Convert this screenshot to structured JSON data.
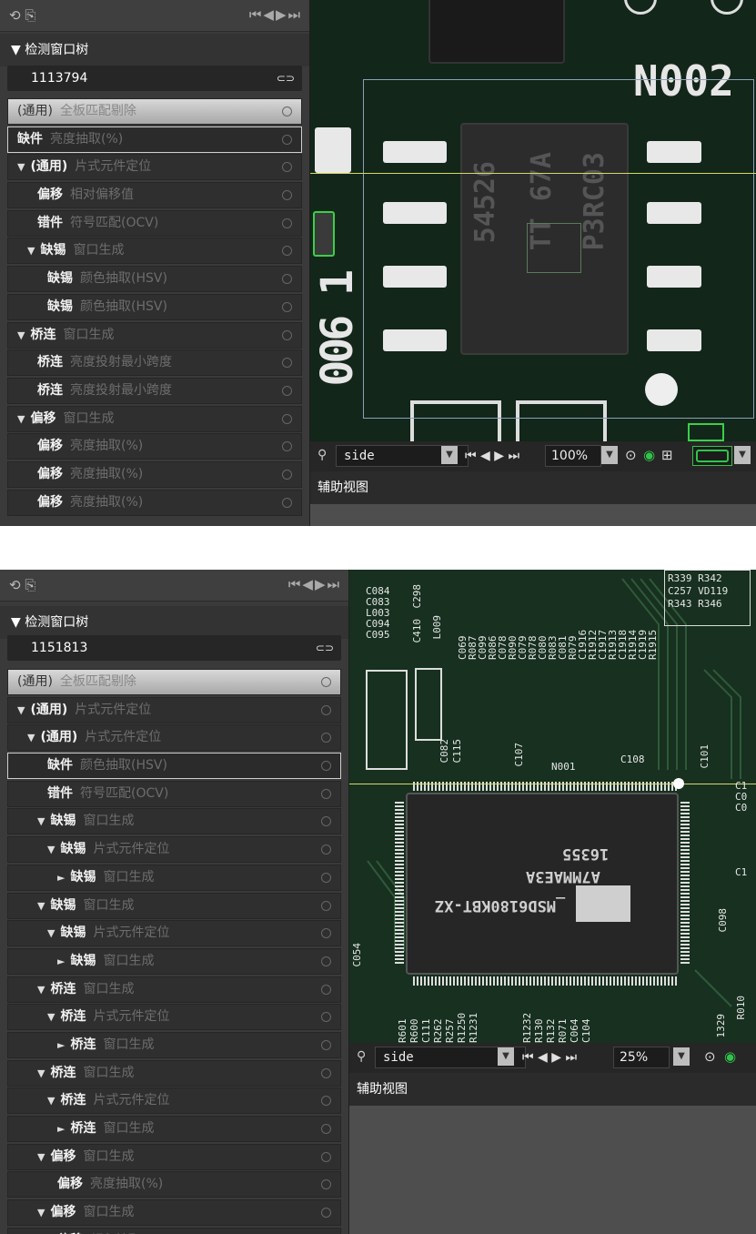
{
  "shot1": {
    "toolbar": {
      "left_icons": "⟲ ⎘",
      "nav": [
        "⏮",
        "◀",
        "▶",
        "⏭"
      ]
    },
    "tree_header": "▼ 检测窗口树",
    "id_value": "1113794",
    "rows": [
      {
        "level": 0,
        "arrow": "",
        "kw": "(通用)",
        "desc": "全板匹配剔除",
        "style": "root"
      },
      {
        "level": 0,
        "arrow": "",
        "kw": "缺件",
        "desc": "亮度抽取(%)",
        "style": "sel"
      },
      {
        "level": 0,
        "arrow": "▼",
        "kw": "(通用)",
        "desc": "片式元件定位"
      },
      {
        "level": 2,
        "arrow": "",
        "kw": "偏移",
        "desc": "相对偏移值"
      },
      {
        "level": 2,
        "arrow": "",
        "kw": "错件",
        "desc": "符号匹配(OCV)"
      },
      {
        "level": 1,
        "arrow": "▼",
        "kw": "缺锡",
        "desc": "窗口生成"
      },
      {
        "level": 3,
        "arrow": "",
        "kw": "缺锡",
        "desc": "颜色抽取(HSV)"
      },
      {
        "level": 3,
        "arrow": "",
        "kw": "缺锡",
        "desc": "颜色抽取(HSV)"
      },
      {
        "level": 0,
        "arrow": "▼",
        "kw": "桥连",
        "desc": "窗口生成"
      },
      {
        "level": 2,
        "arrow": "",
        "kw": "桥连",
        "desc": "亮度投射最小跨度"
      },
      {
        "level": 2,
        "arrow": "",
        "kw": "桥连",
        "desc": "亮度投射最小跨度"
      },
      {
        "level": 0,
        "arrow": "▼",
        "kw": "偏移",
        "desc": "窗口生成"
      },
      {
        "level": 2,
        "arrow": "",
        "kw": "偏移",
        "desc": "亮度抽取(%)"
      },
      {
        "level": 2,
        "arrow": "",
        "kw": "偏移",
        "desc": "亮度抽取(%)"
      },
      {
        "level": 2,
        "arrow": "",
        "kw": "偏移",
        "desc": "亮度抽取(%)"
      }
    ],
    "board": {
      "label_big": "N002",
      "chip_text": [
        "54526",
        "TT 67A",
        "P3RC03"
      ],
      "side_text": "006 1"
    },
    "controls": {
      "view": "side",
      "zoom": "100%"
    },
    "aux_title": "辅助视图"
  },
  "shot2": {
    "toolbar": {
      "left_icons": "⟲ ⎘",
      "nav": [
        "⏮",
        "◀",
        "▶",
        "⏭"
      ]
    },
    "tree_header": "▼ 检测窗口树",
    "id_value": "1151813",
    "rows": [
      {
        "level": 0,
        "arrow": "",
        "kw": "(通用)",
        "desc": "全板匹配剔除",
        "style": "root"
      },
      {
        "level": 0,
        "arrow": "▼",
        "kw": "(通用)",
        "desc": "片式元件定位"
      },
      {
        "level": 1,
        "arrow": "▼",
        "kw": "(通用)",
        "desc": "片式元件定位"
      },
      {
        "level": 3,
        "arrow": "",
        "kw": "缺件",
        "desc": "颜色抽取(HSV)",
        "style": "sel"
      },
      {
        "level": 3,
        "arrow": "",
        "kw": "错件",
        "desc": "符号匹配(OCV)"
      },
      {
        "level": 2,
        "arrow": "▼",
        "kw": "缺锡",
        "desc": "窗口生成"
      },
      {
        "level": 3,
        "arrow": "▼",
        "kw": "缺锡",
        "desc": "片式元件定位"
      },
      {
        "level": 4,
        "arrow": "►",
        "kw": "缺锡",
        "desc": "窗口生成"
      },
      {
        "level": 2,
        "arrow": "▼",
        "kw": "缺锡",
        "desc": "窗口生成"
      },
      {
        "level": 3,
        "arrow": "▼",
        "kw": "缺锡",
        "desc": "片式元件定位"
      },
      {
        "level": 4,
        "arrow": "►",
        "kw": "缺锡",
        "desc": "窗口生成"
      },
      {
        "level": 2,
        "arrow": "▼",
        "kw": "桥连",
        "desc": "窗口生成"
      },
      {
        "level": 3,
        "arrow": "▼",
        "kw": "桥连",
        "desc": "片式元件定位"
      },
      {
        "level": 4,
        "arrow": "►",
        "kw": "桥连",
        "desc": "窗口生成"
      },
      {
        "level": 2,
        "arrow": "▼",
        "kw": "桥连",
        "desc": "窗口生成"
      },
      {
        "level": 3,
        "arrow": "▼",
        "kw": "桥连",
        "desc": "片式元件定位"
      },
      {
        "level": 4,
        "arrow": "►",
        "kw": "桥连",
        "desc": "窗口生成"
      },
      {
        "level": 2,
        "arrow": "▼",
        "kw": "偏移",
        "desc": "窗口生成"
      },
      {
        "level": 4,
        "arrow": "",
        "kw": "偏移",
        "desc": "亮度抽取(%)"
      },
      {
        "level": 2,
        "arrow": "▼",
        "kw": "偏移",
        "desc": "窗口生成"
      },
      {
        "level": 4,
        "arrow": "",
        "kw": "偏移",
        "desc": "颜色抽取(HSV)"
      }
    ],
    "board": {
      "chip_lines": [
        "16355",
        "A7MMAE3A",
        "_MSD6180KBT-XZ"
      ],
      "labels_top": [
        "C084",
        "C083",
        "L003",
        "C094",
        "C095"
      ],
      "labels_misc": [
        "N001",
        "C108",
        "C101",
        "C107",
        "C082",
        "C115",
        "C098",
        "C054",
        "R010",
        "1329"
      ],
      "labels_bottom": [
        "R601",
        "R600",
        "C111",
        "R262",
        "R257",
        "R1250",
        "R1231",
        "R1232",
        "R130",
        "R132",
        "R071",
        "C064",
        "C104"
      ],
      "labels_col": [
        "R087",
        "R086",
        "R090",
        "R078",
        "R083",
        "R079",
        "R1912",
        "R1913",
        "R1914",
        "R1915"
      ],
      "labels_col2": [
        "C069",
        "C099",
        "C078",
        "C079",
        "C080",
        "C081",
        "C1916",
        "C1917",
        "C1918",
        "C1919"
      ],
      "labels_vert": [
        "C298",
        "C410",
        "L009"
      ],
      "labels_right": [
        "R339 R342",
        "C257 VD119",
        "R343 R346"
      ],
      "labels_edge": [
        "C1",
        "C0",
        "C0",
        "C1"
      ]
    },
    "controls": {
      "view": "side",
      "zoom": "25%"
    },
    "aux_title": "辅助视图"
  }
}
